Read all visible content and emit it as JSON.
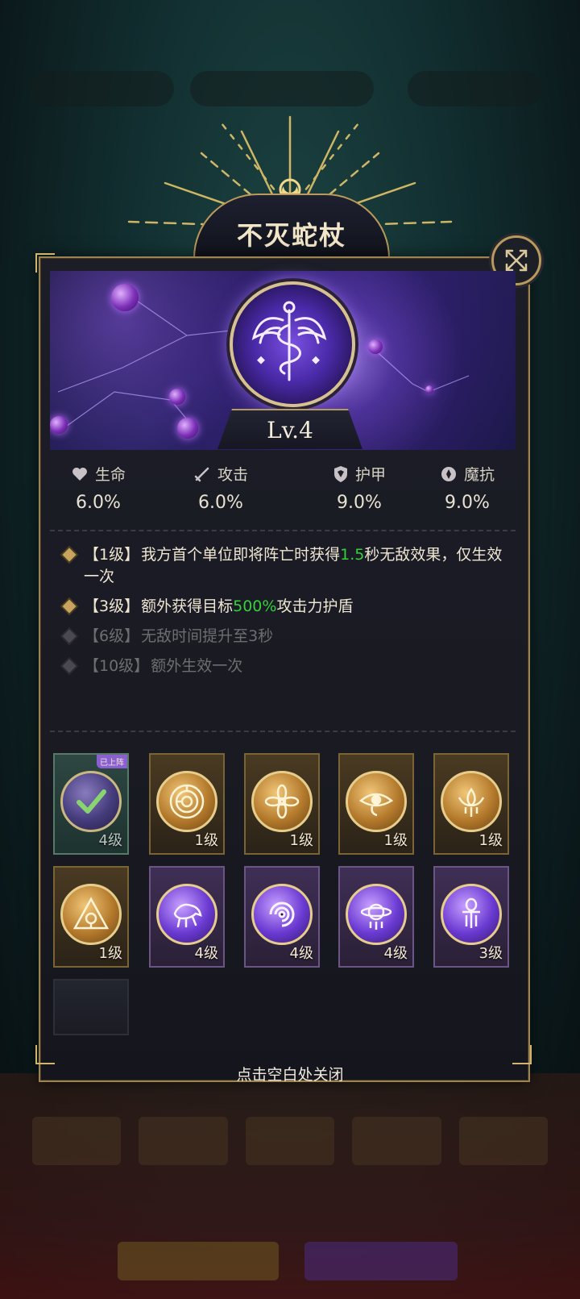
{
  "relic": {
    "title": "不灭蛇杖",
    "level": "Lv.4"
  },
  "stats": [
    {
      "icon": "heart-icon",
      "label": "生命",
      "value": "6.0%"
    },
    {
      "icon": "sword-icon",
      "label": "攻击",
      "value": "6.0%"
    },
    {
      "icon": "shield-icon",
      "label": "护甲",
      "value": "9.0%"
    },
    {
      "icon": "magic-resist-icon",
      "label": "魔抗",
      "value": "9.0%"
    }
  ],
  "effects": [
    {
      "level": "【1级】",
      "pre": "我方首个单位即将阵亡时获得",
      "highlight": "1.5",
      "post": "秒无敌效果，仅生效一次",
      "unlocked": true
    },
    {
      "level": "【3级】",
      "pre": "额外获得目标",
      "highlight": "500%",
      "post": "攻击力护盾",
      "unlocked": true
    },
    {
      "level": "【6级】",
      "pre": "无敌时间提升至3秒",
      "highlight": "",
      "post": "",
      "unlocked": false
    },
    {
      "level": "【10级】",
      "pre": "额外生效一次",
      "highlight": "",
      "post": "",
      "unlocked": false
    }
  ],
  "relics": [
    {
      "icon": "serpent-staff-icon",
      "level": "4级",
      "style": "equipped",
      "badge": "已上阵"
    },
    {
      "icon": "maze-icon",
      "level": "1级",
      "style": "gold"
    },
    {
      "icon": "lotus-flower-icon",
      "level": "1级",
      "style": "gold"
    },
    {
      "icon": "eye-of-horus-icon",
      "level": "1级",
      "style": "gold"
    },
    {
      "icon": "lotus-pendant-icon",
      "level": "1级",
      "style": "gold"
    },
    {
      "icon": "triangle-eye-icon",
      "level": "1级",
      "style": "gold"
    },
    {
      "icon": "horse-icon",
      "level": "4级",
      "style": "purple"
    },
    {
      "icon": "vortex-icon",
      "level": "4级",
      "style": "purple"
    },
    {
      "icon": "moon-planet-icon",
      "level": "4级",
      "style": "purple"
    },
    {
      "icon": "ankh-figure-icon",
      "level": "3级",
      "style": "purple"
    }
  ],
  "close_hint": "点击空白处关闭",
  "colors": {
    "gold_border": "#b99a5a",
    "highlight_green": "#35d13a",
    "panel_bg": "#1c1d27"
  }
}
